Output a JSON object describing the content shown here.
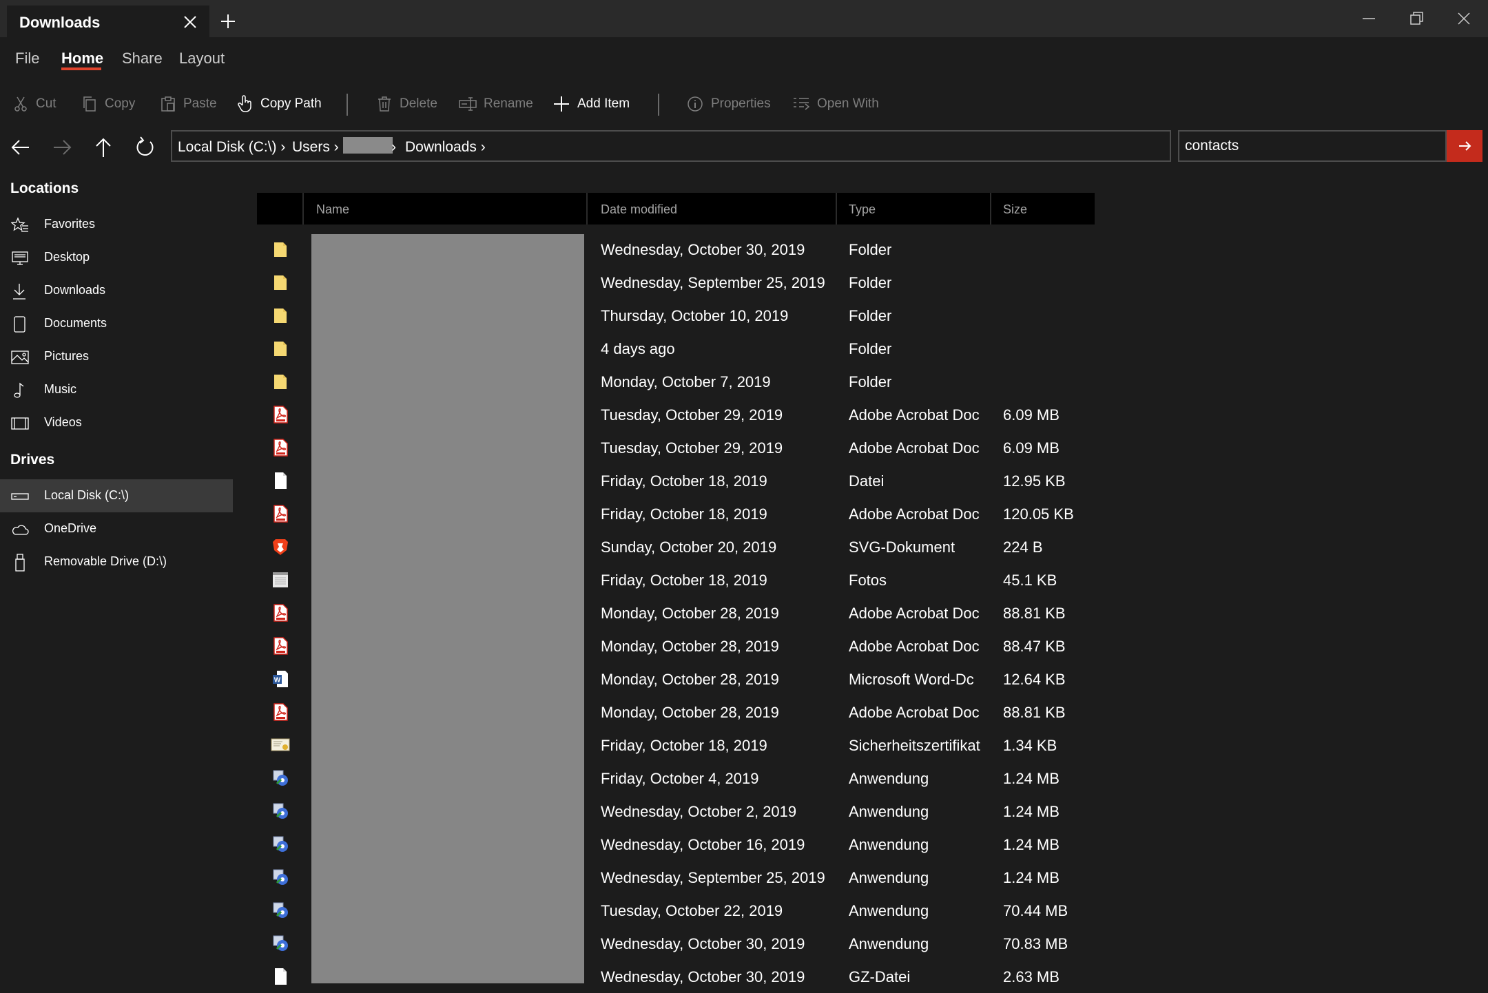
{
  "window": {
    "tab_title": "Downloads",
    "icons": {
      "close_tab": "close-icon",
      "new_tab": "plus-icon",
      "minimize": "minimize-icon",
      "maximize": "restore-icon",
      "close": "close-icon"
    }
  },
  "menu": {
    "items": [
      "File",
      "Home",
      "Share",
      "Layout"
    ],
    "active": "Home",
    "accent": "#e0442d"
  },
  "toolbar": {
    "cut": "Cut",
    "copy": "Copy",
    "paste": "Paste",
    "copy_path": "Copy Path",
    "delete": "Delete",
    "rename": "Rename",
    "add_item": "Add Item",
    "properties": "Properties",
    "open_with": "Open With"
  },
  "address": {
    "crumbs": [
      "Local Disk (C:\\) ›",
      "Users ›",
      "›",
      "Downloads ›"
    ]
  },
  "search": {
    "value": "contacts",
    "button_color": "#c42b1c"
  },
  "sidebar": {
    "locations_heading": "Locations",
    "locations": [
      "Favorites",
      "Desktop",
      "Downloads",
      "Documents",
      "Pictures",
      "Music",
      "Videos"
    ],
    "drives_heading": "Drives",
    "drives": [
      "Local Disk (C:\\)",
      "OneDrive",
      "Removable Drive (D:\\)"
    ],
    "selected": "Local Disk (C:\\)"
  },
  "columns": {
    "name": "Name",
    "date": "Date modified",
    "type": "Type",
    "size": "Size"
  },
  "files": [
    {
      "icon": "folder-icon",
      "date": "Wednesday, October 30, 2019",
      "type": "Folder",
      "size": ""
    },
    {
      "icon": "folder-icon",
      "date": "Wednesday, September 25, 2019",
      "type": "Folder",
      "size": ""
    },
    {
      "icon": "folder-icon",
      "date": "Thursday, October 10, 2019",
      "type": "Folder",
      "size": ""
    },
    {
      "icon": "folder-icon",
      "date": "4 days ago",
      "type": "Folder",
      "size": ""
    },
    {
      "icon": "folder-icon",
      "date": "Monday, October 7, 2019",
      "type": "Folder",
      "size": ""
    },
    {
      "icon": "pdf-icon",
      "date": "Tuesday, October 29, 2019",
      "type": "Adobe Acrobat Doc",
      "size": "6.09 MB"
    },
    {
      "icon": "pdf-icon",
      "date": "Tuesday, October 29, 2019",
      "type": "Adobe Acrobat Doc",
      "size": "6.09 MB"
    },
    {
      "icon": "file-icon",
      "date": "Friday, October 18, 2019",
      "type": "Datei",
      "size": "12.95 KB"
    },
    {
      "icon": "pdf-icon",
      "date": "Friday, October 18, 2019",
      "type": "Adobe Acrobat Doc",
      "size": "120.05 KB"
    },
    {
      "icon": "brave-icon",
      "date": "Sunday, October 20, 2019",
      "type": "SVG-Dokument",
      "size": "224 B"
    },
    {
      "icon": "image-icon",
      "date": "Friday, October 18, 2019",
      "type": "Fotos",
      "size": "45.1 KB"
    },
    {
      "icon": "pdf-icon",
      "date": "Monday, October 28, 2019",
      "type": "Adobe Acrobat Doc",
      "size": "88.81 KB"
    },
    {
      "icon": "pdf-icon",
      "date": "Monday, October 28, 2019",
      "type": "Adobe Acrobat Doc",
      "size": "88.47 KB"
    },
    {
      "icon": "word-icon",
      "date": "Monday, October 28, 2019",
      "type": "Microsoft Word-Dc",
      "size": "12.64 KB"
    },
    {
      "icon": "pdf-icon",
      "date": "Monday, October 28, 2019",
      "type": "Adobe Acrobat Doc",
      "size": "88.81 KB"
    },
    {
      "icon": "certificate-icon",
      "date": "Friday, October 18, 2019",
      "type": "Sicherheitszertifikat",
      "size": "1.34 KB"
    },
    {
      "icon": "installer-icon",
      "date": "Friday, October 4, 2019",
      "type": "Anwendung",
      "size": "1.24 MB"
    },
    {
      "icon": "installer-icon",
      "date": "Wednesday, October 2, 2019",
      "type": "Anwendung",
      "size": "1.24 MB"
    },
    {
      "icon": "installer-icon",
      "date": "Wednesday, October 16, 2019",
      "type": "Anwendung",
      "size": "1.24 MB"
    },
    {
      "icon": "installer-icon",
      "date": "Wednesday, September 25, 2019",
      "type": "Anwendung",
      "size": "1.24 MB"
    },
    {
      "icon": "installer-icon",
      "date": "Tuesday, October 22, 2019",
      "type": "Anwendung",
      "size": "70.44 MB"
    },
    {
      "icon": "installer-icon",
      "date": "Wednesday, October 30, 2019",
      "type": "Anwendung",
      "size": "70.83 MB"
    },
    {
      "icon": "file-icon",
      "date": "Wednesday, October 30, 2019",
      "type": "GZ-Datei",
      "size": "2.63 MB"
    }
  ]
}
